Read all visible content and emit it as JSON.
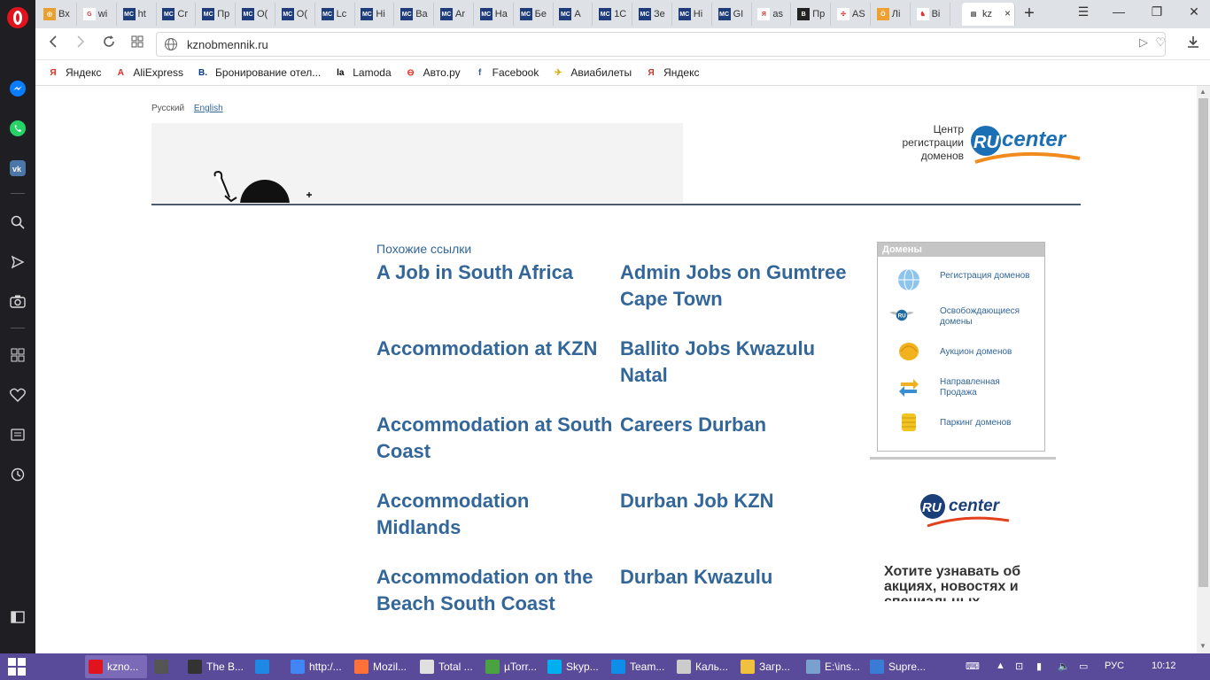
{
  "browser": {
    "tabs": [
      {
        "label": "Вх",
        "fav_color": "#e8a030",
        "fav_text": "◎"
      },
      {
        "label": "wi",
        "fav_color": "#ffffff",
        "fav_text": "G"
      },
      {
        "label": "ht",
        "fav_color": "#1f3d7a",
        "fav_text": "MC"
      },
      {
        "label": "Сг",
        "fav_color": "#1f3d7a",
        "fav_text": "MC"
      },
      {
        "label": "Пр",
        "fav_color": "#1f3d7a",
        "fav_text": "MC"
      },
      {
        "label": "О(",
        "fav_color": "#1f3d7a",
        "fav_text": "MC"
      },
      {
        "label": "О(",
        "fav_color": "#1f3d7a",
        "fav_text": "MC"
      },
      {
        "label": "Lc",
        "fav_color": "#1f3d7a",
        "fav_text": "MC"
      },
      {
        "label": "Ні",
        "fav_color": "#1f3d7a",
        "fav_text": "MC"
      },
      {
        "label": "Ва",
        "fav_color": "#1f3d7a",
        "fav_text": "MC"
      },
      {
        "label": "Ar",
        "fav_color": "#1f3d7a",
        "fav_text": "MC"
      },
      {
        "label": "На",
        "fav_color": "#1f3d7a",
        "fav_text": "MC"
      },
      {
        "label": "Бе",
        "fav_color": "#1f3d7a",
        "fav_text": "MC"
      },
      {
        "label": "А",
        "fav_color": "#1f3d7a",
        "fav_text": "MC"
      },
      {
        "label": "1С",
        "fav_color": "#1f3d7a",
        "fav_text": "MC"
      },
      {
        "label": "Зе",
        "fav_color": "#1f3d7a",
        "fav_text": "MC"
      },
      {
        "label": "Ні",
        "fav_color": "#1f3d7a",
        "fav_text": "MC"
      },
      {
        "label": "GI",
        "fav_color": "#1f3d7a",
        "fav_text": "MC"
      },
      {
        "label": "as",
        "fav_color": "#ffffff",
        "fav_text": "Я"
      },
      {
        "label": "Пр",
        "fav_color": "#222222",
        "fav_text": "B"
      },
      {
        "label": "AS",
        "fav_color": "#ffffff",
        "fav_text": "✣"
      },
      {
        "label": "Лі",
        "fav_color": "#f0a030",
        "fav_text": "Ö"
      },
      {
        "label": "Bi",
        "fav_color": "#ffffff",
        "fav_text": "♞"
      }
    ],
    "active_tab": {
      "label": "kz",
      "close": "×"
    },
    "new_tab": "+",
    "url": "kznobmennik.ru",
    "bookmarks": [
      {
        "label": "Яндекс",
        "icon": "Я",
        "color": "#e8291c"
      },
      {
        "label": "AliExpress",
        "icon": "A",
        "color": "#e8291c"
      },
      {
        "label": "Бронирование отел...",
        "icon": "B.",
        "color": "#003580"
      },
      {
        "label": "Lamoda",
        "icon": "la",
        "color": "#000000"
      },
      {
        "label": "Авто.ру",
        "icon": "⊖",
        "color": "#e8291c"
      },
      {
        "label": "Facebook",
        "icon": "f",
        "color": "#3b5998"
      },
      {
        "label": "Авиабилеты",
        "icon": "✈",
        "color": "#e0a800"
      },
      {
        "label": "Яндекс",
        "icon": "Я",
        "color": "#c0392b"
      }
    ]
  },
  "page": {
    "lang_ru": "Русский",
    "lang_en": "English",
    "rucenter_caption": [
      "Центр",
      "регистрации",
      "доменов"
    ],
    "rucenter_logo_ru": "RU",
    "rucenter_logo_center": "center",
    "related_caption": "Похожие ссылки",
    "links": [
      "A Job in South Africa",
      "Admin Jobs on Gumtree Cape Town",
      "Accommodation at KZN",
      "Ballito Jobs Kwazulu Natal",
      "Accommodation at South Coast",
      "Careers Durban",
      "Accommodation Midlands",
      "Durban Job KZN",
      "Accommodation on the Beach South Coast",
      "Durban Kwazulu"
    ],
    "domains_title": "Домены",
    "domain_items": [
      {
        "label": "Регистрация доменов",
        "icon": "globe-icon",
        "color": "#6aaee0"
      },
      {
        "label": "Освобождающиеся домены",
        "icon": "ru-wings-icon",
        "color": "#2a6fa0"
      },
      {
        "label": "Аукцион доменов",
        "icon": "auction-icon",
        "color": "#f0b020"
      },
      {
        "label": "Направленная Продажа",
        "icon": "arrows-icon",
        "color": "#3a8fd0"
      },
      {
        "label": "Паркинг доменов",
        "icon": "coins-icon",
        "color": "#f0c020"
      }
    ],
    "promo_text": "Хотите узнавать об акциях, новостях и специальных"
  },
  "taskbar": {
    "items": [
      {
        "label": "kzno...",
        "color": "#e0141e",
        "active": true
      },
      {
        "label": "",
        "color": "#555555",
        "active": false
      },
      {
        "label": "The B...",
        "color": "#333333",
        "active": false
      },
      {
        "label": "",
        "color": "#1e88e5",
        "active": false
      },
      {
        "label": "http:/...",
        "color": "#4285f4",
        "active": false
      },
      {
        "label": "Mozil...",
        "color": "#ff7139",
        "active": false
      },
      {
        "label": "Total ...",
        "color": "#e0e0e0",
        "active": false
      },
      {
        "label": "µTorr...",
        "color": "#4aa340",
        "active": false
      },
      {
        "label": "Skyp...",
        "color": "#00aff0",
        "active": false
      },
      {
        "label": "Team...",
        "color": "#0e8ee9",
        "active": false
      },
      {
        "label": "Каль...",
        "color": "#cccccc",
        "active": false
      },
      {
        "label": "Загр...",
        "color": "#f0c040",
        "active": false
      },
      {
        "label": "E:\\ins...",
        "color": "#7aa0d0",
        "active": false
      },
      {
        "label": "Supre...",
        "color": "#3a7bd5",
        "active": false
      }
    ],
    "lang": "РУС",
    "time": "10:12"
  },
  "colors": {
    "link": "#336699",
    "taskbar": "#5a4a9a",
    "sidebar": "#1f1f23"
  }
}
